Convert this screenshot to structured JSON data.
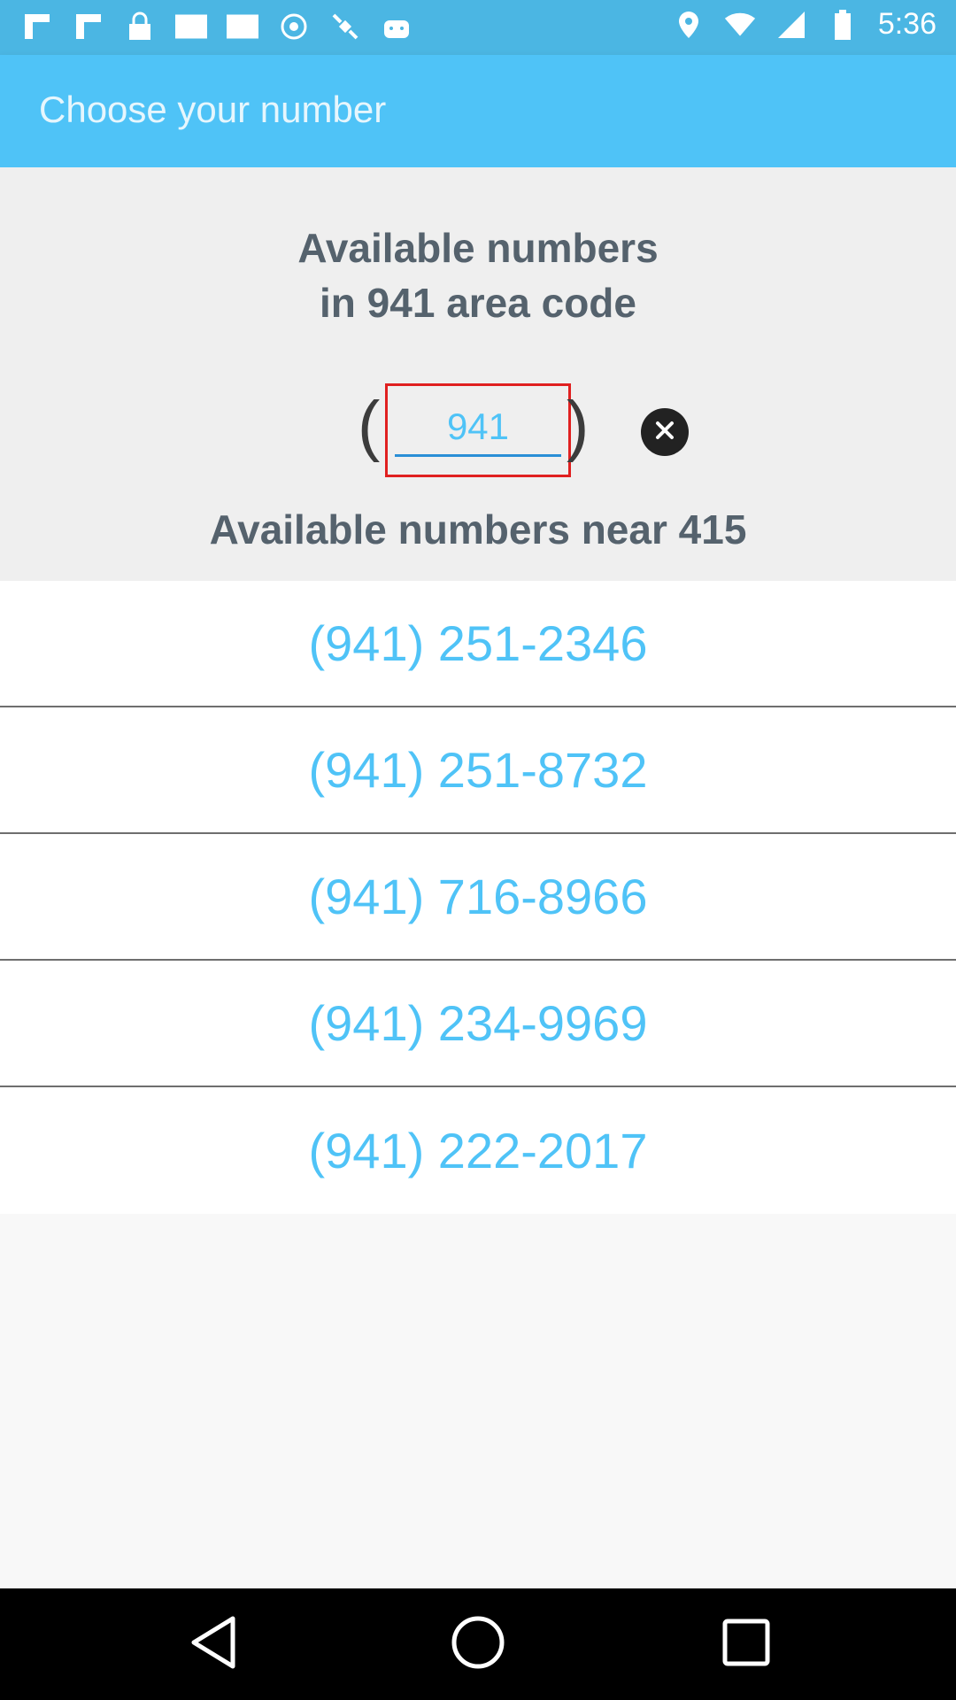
{
  "status_bar": {
    "time": "5:36",
    "icons": [
      "flipboard-icon",
      "flipboard-icon",
      "lock-icon",
      "blank-icon",
      "blank-icon",
      "sync-icon",
      "satellite-icon",
      "android-icon",
      "location-icon",
      "wifi-icon",
      "signal-icon",
      "battery-icon"
    ]
  },
  "app_bar": {
    "title": "Choose your number"
  },
  "area_code_section": {
    "heading_line1": "Available numbers",
    "heading_line2": "in 941 area code",
    "open_paren": "(",
    "close_paren": ")",
    "area_code_value": "941",
    "clear_icon": "close-circle-icon"
  },
  "near_heading": "Available numbers near 415",
  "numbers": [
    "(941) 251-2346",
    "(941) 251-8732",
    "(941) 716-8966",
    "(941) 234-9969",
    "(941) 222-2017"
  ],
  "colors": {
    "app_bar": "#4fc3f7",
    "status_bar": "#4bb6e3",
    "accent_text": "#4fc3f7",
    "highlight_border": "#e02020"
  },
  "nav_bar": {
    "icons": [
      "back-icon",
      "home-icon",
      "recents-icon"
    ]
  }
}
